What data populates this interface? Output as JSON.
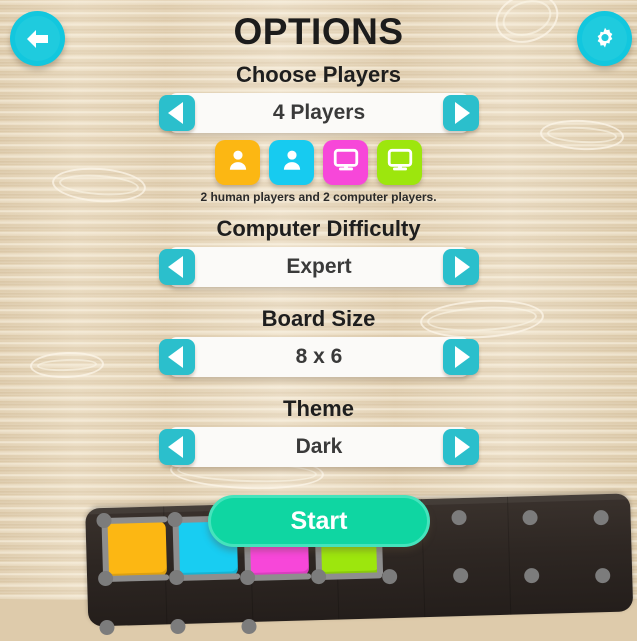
{
  "header": {
    "title": "OPTIONS",
    "back_icon": "back-arrow-icon",
    "settings_icon": "gear-icon"
  },
  "sections": {
    "players": {
      "label": "Choose Players",
      "value": "4 Players",
      "caption": "2 human players and 2 computer players.",
      "tiles": [
        {
          "type": "human",
          "icon": "person-icon",
          "color": "#FCB713"
        },
        {
          "type": "human",
          "icon": "person-icon",
          "color": "#17CBF0"
        },
        {
          "type": "computer",
          "icon": "monitor-icon",
          "color": "#F747D9"
        },
        {
          "type": "computer",
          "icon": "monitor-icon",
          "color": "#9DE60D"
        }
      ]
    },
    "difficulty": {
      "label": "Computer Difficulty",
      "value": "Expert"
    },
    "board_size": {
      "label": "Board Size",
      "value": "8 x 6"
    },
    "theme": {
      "label": "Theme",
      "value": "Dark"
    }
  },
  "arrows": {
    "prev_icon": "chevron-left-icon",
    "next_icon": "chevron-right-icon"
  },
  "start": {
    "label": "Start"
  },
  "colors": {
    "accent_teal": "#2BBFCC",
    "round_button": "#12C7DE",
    "start_green": "#0FD6A2",
    "start_border": "#45E3BC",
    "wood_base": "#DFCCAC",
    "wood_grain": "#F2E6D2",
    "board_dark": "#2E2723",
    "board_dot": "#7C7C7C",
    "board_edge": "#8E8E8E",
    "text_dark": "#1C1C1C",
    "selector_bg": "#FBFAF8"
  },
  "board_preview": {
    "cells": [
      {
        "color": "#FCB713"
      },
      {
        "color": "#18CDF2"
      },
      {
        "color": "#F747D9"
      },
      {
        "color": "#9DE60D"
      }
    ]
  }
}
